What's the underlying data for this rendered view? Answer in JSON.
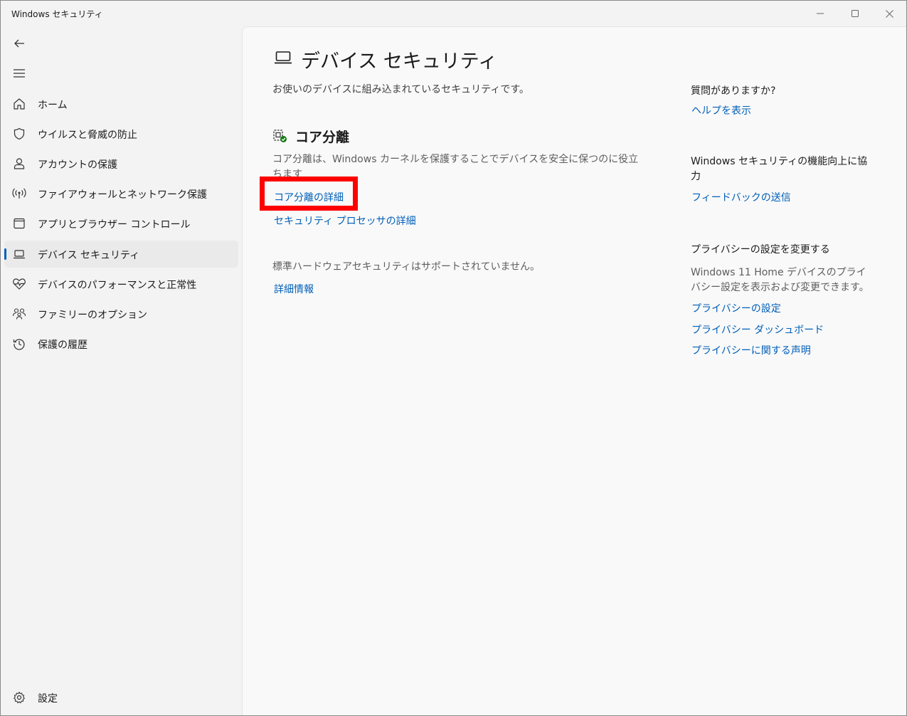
{
  "window": {
    "title": "Windows セキュリティ",
    "minimize_glyph": "—",
    "maximize_glyph": "☐",
    "close_glyph": "✕"
  },
  "nav": {
    "back_icon": "arrow-left-icon",
    "menu_icon": "hamburger-icon",
    "items": [
      {
        "label": "ホーム",
        "icon": "home-icon"
      },
      {
        "label": "ウイルスと脅威の防止",
        "icon": "shield-icon"
      },
      {
        "label": "アカウントの保護",
        "icon": "person-icon"
      },
      {
        "label": "ファイアウォールとネットワーク保護",
        "icon": "antenna-icon"
      },
      {
        "label": "アプリとブラウザー コントロール",
        "icon": "app-window-icon"
      },
      {
        "label": "デバイス セキュリティ",
        "icon": "laptop-icon",
        "active": true
      },
      {
        "label": "デバイスのパフォーマンスと正常性",
        "icon": "heart-pulse-icon"
      },
      {
        "label": "ファミリーのオプション",
        "icon": "family-icon"
      },
      {
        "label": "保護の履歴",
        "icon": "history-icon"
      }
    ],
    "settings_label": "設定"
  },
  "main": {
    "title": "デバイス セキュリティ",
    "description": "お使いのデバイスに組み込まれているセキュリティです。",
    "core_isolation": {
      "title": "コア分離",
      "description": "コア分離は、Windows カーネルを保護することでデバイスを安全に保つのに役立ちます",
      "details_link": "コア分離の詳細",
      "processor_link": "セキュリティ プロセッサの詳細"
    },
    "hardware_note": "標準ハードウェアセキュリティはサポートされていません。",
    "more_info_link": "詳細情報"
  },
  "aside": {
    "question": "質問がありますか?",
    "help_link": "ヘルプを表示",
    "improve": "Windows セキュリティの機能向上に協力",
    "feedback_link": "フィードバックの送信",
    "privacy_head": "プライバシーの設定を変更する",
    "privacy_text": "Windows 11 Home デバイスのプライバシー設定を表示および変更できます。",
    "privacy_settings_link": "プライバシーの設定",
    "privacy_dashboard_link": "プライバシー ダッシュボード",
    "privacy_statement_link": "プライバシーに関する声明"
  },
  "colors": {
    "accent": "#005fb8",
    "highlight_box": "#ff0000"
  }
}
